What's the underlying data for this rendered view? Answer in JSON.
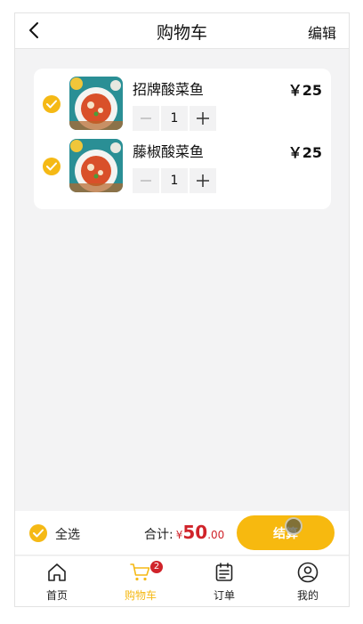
{
  "header": {
    "title": "购物车",
    "edit_label": "编辑"
  },
  "cart": {
    "items": [
      {
        "name": "招牌酸菜鱼",
        "price": "￥25",
        "quantity": "1"
      },
      {
        "name": "藤椒酸菜鱼",
        "price": "￥25",
        "quantity": "1"
      }
    ]
  },
  "footer": {
    "select_all_label": "全选",
    "total_label": "合计:",
    "currency": "¥",
    "total_integer": "50",
    "total_decimal": ".00",
    "checkout_label": "结算"
  },
  "tabbar": {
    "items": [
      {
        "label": "首页",
        "icon": "home-icon"
      },
      {
        "label": "购物车",
        "icon": "cart-icon",
        "badge": "2",
        "active": true
      },
      {
        "label": "订单",
        "icon": "orders-icon"
      },
      {
        "label": "我的",
        "icon": "profile-icon"
      }
    ]
  },
  "colors": {
    "accent": "#f5b915",
    "price_red": "#d0232a",
    "background": "#f3f3f4"
  }
}
